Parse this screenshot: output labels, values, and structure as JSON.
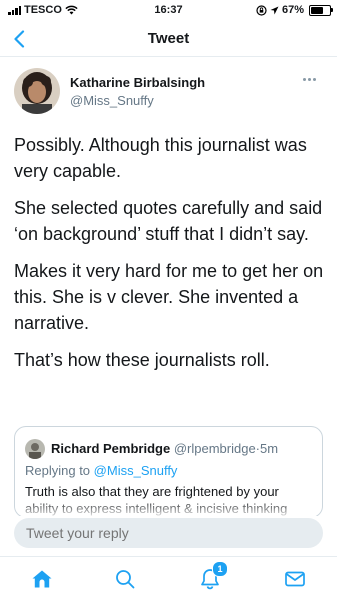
{
  "status_bar": {
    "carrier": "TESCO",
    "time": "16:37",
    "battery": "67%",
    "battery_level": 0.67
  },
  "nav": {
    "title": "Tweet",
    "back_icon": "chevron-left-icon"
  },
  "tweet": {
    "author_name": "Katharine Birbalsingh",
    "author_handle": "@Miss_Snuffy",
    "paragraphs": [
      "Possibly. Although this journalist was very capable.",
      "She selected quotes carefully and said ‘on background’ stuff that I didn’t say.",
      "Makes it very hard for me to get her on this. She is v clever. She invented a narrative.",
      "That’s how these journalists roll."
    ]
  },
  "quote": {
    "name": "Richard Pembridge",
    "handle": "@rlpembridge",
    "separator": "·",
    "time": "5m",
    "replying_prefix": "Replying to",
    "replying_handle": "@Miss_Snuffy",
    "text": "Truth is also that they are frightened by your ability to express intelligent & incisive thinking"
  },
  "reply": {
    "placeholder": "Tweet your reply"
  },
  "tab_bar": {
    "notification_count": "1",
    "accent_color": "#1da1f2"
  }
}
